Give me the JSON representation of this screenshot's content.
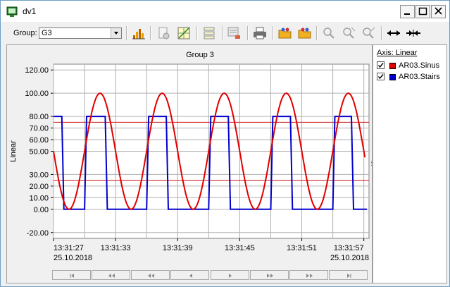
{
  "window": {
    "title": "dv1"
  },
  "toolbar": {
    "group_label": "Group:",
    "group_value": "G3"
  },
  "chart_data": {
    "type": "line",
    "title": "Group 3",
    "ylabel": "Linear",
    "ylim": [
      -25,
      125
    ],
    "yticks": [
      "-20.00",
      "0.00",
      "10.00",
      "20.00",
      "30.00",
      "50.00",
      "60.00",
      "70.00",
      "80.00",
      "100.00",
      "120.00"
    ],
    "xticks": [
      "13:31:27",
      "13:31:33",
      "13:31:39",
      "13:31:45",
      "13:31:51",
      "13:31:57"
    ],
    "date_left": "25.10.2018",
    "date_right": "25.10.2018",
    "hlines": [
      75,
      25
    ],
    "series": [
      {
        "name": "AR03.Sinus",
        "color": "#e00000",
        "period_s": 6,
        "min": 0,
        "max": 100,
        "start_value": 50
      },
      {
        "name": "AR03.Stairs",
        "color": "#0000cc",
        "x": [
          0,
          0.8,
          1.0,
          3.0,
          3.2,
          5.0,
          5.2,
          9.0,
          9.2,
          10.9,
          11.1,
          15.0,
          15.2,
          16.9,
          17.1,
          21.0,
          21.2,
          22.9,
          23.1,
          27.0,
          27.2,
          28.8,
          29.0,
          30.3
        ],
        "y": [
          80,
          80,
          0,
          0,
          80,
          80,
          0,
          0,
          80,
          80,
          0,
          0,
          80,
          80,
          0,
          0,
          80,
          80,
          0,
          0,
          80,
          80,
          0,
          0
        ]
      }
    ]
  },
  "legend": {
    "title": "Axis: Linear",
    "items": [
      {
        "label": "AR03.Sinus",
        "color": "#e00000",
        "checked": "✓"
      },
      {
        "label": "AR03.Stairs",
        "color": "#0000cc",
        "checked": "✓"
      }
    ]
  },
  "scroll": {
    "buttons": [
      "first",
      "fast-back",
      "back",
      "step-back",
      "step-forward",
      "forward",
      "fast-forward",
      "last"
    ]
  }
}
